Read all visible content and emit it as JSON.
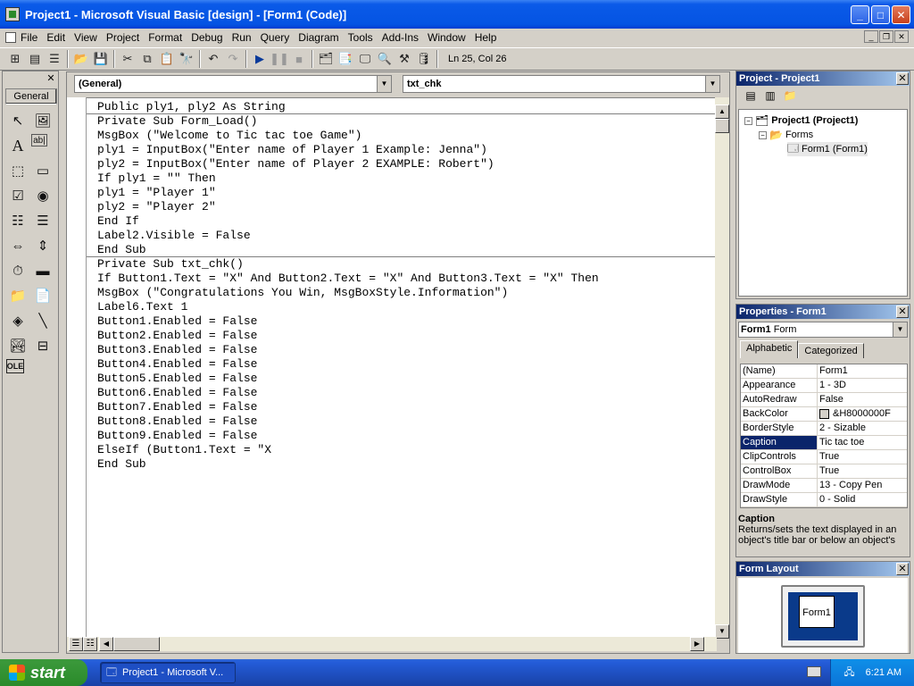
{
  "window": {
    "title": "Project1 - Microsoft Visual Basic [design] - [Form1 (Code)]"
  },
  "menu": [
    "File",
    "Edit",
    "View",
    "Project",
    "Format",
    "Debug",
    "Run",
    "Query",
    "Diagram",
    "Tools",
    "Add-Ins",
    "Window",
    "Help"
  ],
  "toolbar": {
    "position": "Ln 25, Col 26"
  },
  "toolbox": {
    "tab": "General"
  },
  "code": {
    "object_combo": "(General)",
    "proc_combo": "txt_chk",
    "lines": [
      "Public ply1, ply2 As String",
      "Private Sub Form_Load()",
      "MsgBox (\"Welcome to Tic tac toe Game\")",
      "ply1 = InputBox(\"Enter name of Player 1 Example: Jenna\")",
      "ply2 = InputBox(\"Enter name of Player 2 EXAMPLE: Robert\")",
      "If ply1 = \"\" Then",
      "ply1 = \"Player 1\"",
      "ply2 = \"Player 2\"",
      "End If",
      "Label2.Visible = False",
      "End Sub",
      "Private Sub txt_chk()",
      "If Button1.Text = \"X\" And Button2.Text = \"X\" And Button3.Text = \"X\" Then",
      "MsgBox (\"Congratulations You Win, MsgBoxStyle.Information\")",
      "Label6.Text 1",
      "Button1.Enabled = False",
      "Button2.Enabled = False",
      "Button3.Enabled = False",
      "Button4.Enabled = False",
      "Button5.Enabled = False",
      "Button6.Enabled = False",
      "Button7.Enabled = False",
      "Button8.Enabled = False",
      "Button9.Enabled = False",
      "ElseIf (Button1.Text = \"X",
      "End Sub"
    ]
  },
  "project": {
    "title": "Project - Project1",
    "root": "Project1 (Project1)",
    "folder": "Forms",
    "item": "Form1 (Form1)"
  },
  "properties": {
    "title": "Properties - Form1",
    "object_name": "Form1",
    "object_type": "Form",
    "tabs": [
      "Alphabetic",
      "Categorized"
    ],
    "rows": [
      {
        "name": "(Name)",
        "value": "Form1"
      },
      {
        "name": "Appearance",
        "value": "1 - 3D"
      },
      {
        "name": "AutoRedraw",
        "value": "False"
      },
      {
        "name": "BackColor",
        "value": "&H8000000F"
      },
      {
        "name": "BorderStyle",
        "value": "2 - Sizable"
      },
      {
        "name": "Caption",
        "value": "Tic tac toe"
      },
      {
        "name": "ClipControls",
        "value": "True"
      },
      {
        "name": "ControlBox",
        "value": "True"
      },
      {
        "name": "DrawMode",
        "value": "13 - Copy Pen"
      },
      {
        "name": "DrawStyle",
        "value": "0 - Solid"
      }
    ],
    "desc_title": "Caption",
    "desc_text": "Returns/sets the text displayed in an object's title bar or below an object's"
  },
  "form_layout": {
    "title": "Form Layout",
    "form_label": "Form1"
  },
  "taskbar": {
    "start": "start",
    "task": "Project1 - Microsoft V...",
    "clock": "6:21 AM"
  }
}
